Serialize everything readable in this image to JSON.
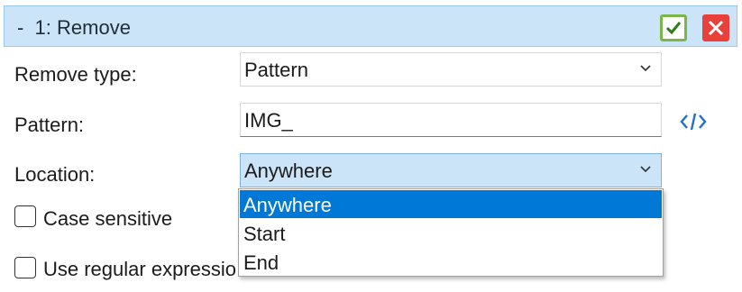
{
  "header": {
    "title": "-  1: Remove"
  },
  "form": {
    "remove_type_label": "Remove type:",
    "remove_type_value": "Pattern",
    "pattern_label": "Pattern:",
    "pattern_value": "IMG_",
    "location_label": "Location:",
    "location_value": "Anywhere",
    "location_options": [
      "Anywhere",
      "Start",
      "End"
    ],
    "case_sensitive_label": "Case sensitive",
    "regex_label": "Use regular expressio"
  },
  "colors": {
    "header_bg": "#cce4f7",
    "accept": "#7ab648",
    "close": "#e8413c",
    "selection": "#0078d7"
  },
  "icons": [
    "check-icon",
    "close-icon",
    "chevron-down-icon",
    "code-icon"
  ]
}
